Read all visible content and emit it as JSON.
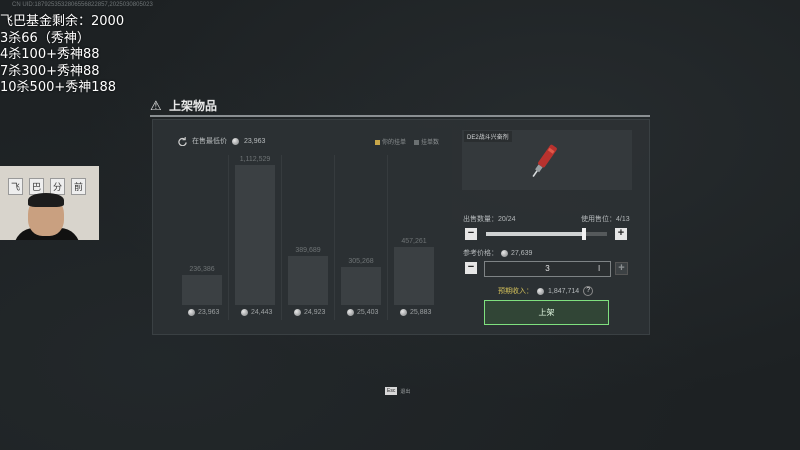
{
  "stream": {
    "uid": "CN UID:1879253532806556822857,2025030805023",
    "overlay_lines": [
      "飞巴基金剩余：2000",
      "3杀66（秀神）",
      "4杀100+秀神88",
      "7杀300+秀神88",
      "10杀500+秀神188"
    ],
    "webcam_sign": [
      "飞",
      "巴",
      "分",
      "前"
    ]
  },
  "header": {
    "title": "上架物品",
    "icon": "warning-triangle-icon"
  },
  "chart": {
    "lowest_label": "在售最低价",
    "lowest_value": "23,963",
    "legend": [
      {
        "label": "你的挂单",
        "color": "#c9a74a"
      },
      {
        "label": "挂单数",
        "color": "#6b7072"
      }
    ]
  },
  "chart_data": {
    "type": "bar",
    "categories": [
      "23,963",
      "24,443",
      "24,923",
      "25,403",
      "25,883"
    ],
    "values": [
      236386,
      1112529,
      389689,
      305268,
      457261
    ],
    "labels": [
      "236,386",
      "1,112,529",
      "389,689",
      "305,268",
      "457,261"
    ],
    "ylim": [
      0,
      1150000
    ]
  },
  "item": {
    "name": "DE2战斗兴奋剂",
    "icon": "stimulant-syringe-icon"
  },
  "sell": {
    "qty_label": "出售数量：20/24",
    "stack_label": "使用售位：4/13",
    "slider_fraction": 0.8,
    "ref_price_label": "参考价格：",
    "ref_price_value": "27,639",
    "qty_value": "3",
    "expected_label": "预期收入：",
    "expected_value": "1,847,714",
    "help": "?",
    "list_button": "上架",
    "minus": "−",
    "plus": "+"
  },
  "footer": {
    "esc_key": "Esc",
    "esc_label": "退出"
  },
  "colors": {
    "accent_green": "#7fe07f",
    "income_yellow": "#d4c15a"
  }
}
